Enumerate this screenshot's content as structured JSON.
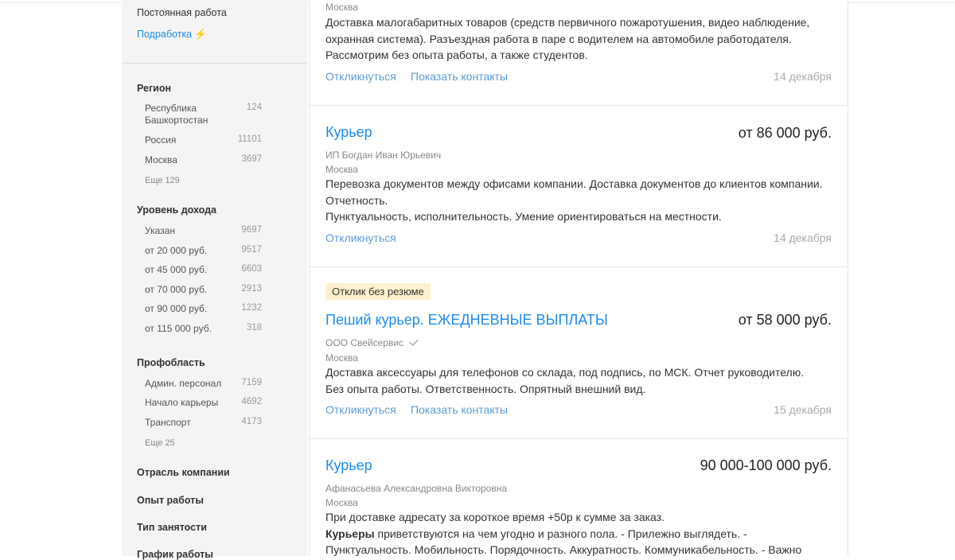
{
  "sidebar": {
    "employment_links": [
      {
        "label": "Постоянная работа"
      },
      {
        "label": "Подработка",
        "icon": "lightning-icon"
      }
    ],
    "region": {
      "heading": "Регион",
      "items": [
        {
          "label": "Республика Башкортостан",
          "count": "124"
        },
        {
          "label": "Россия",
          "count": "11101"
        },
        {
          "label": "Москва",
          "count": "3697"
        }
      ],
      "more": "Еще 129"
    },
    "income": {
      "heading": "Уровень дохода",
      "items": [
        {
          "label": "Указан",
          "count": "9697"
        },
        {
          "label": "от 20 000 руб.",
          "count": "9517"
        },
        {
          "label": "от 45 000 руб.",
          "count": "6603"
        },
        {
          "label": "от 70 000 руб.",
          "count": "2913"
        },
        {
          "label": "от 90 000 руб.",
          "count": "1232"
        },
        {
          "label": "от 115 000 руб.",
          "count": "318"
        }
      ]
    },
    "profarea": {
      "heading": "Профобласть",
      "items": [
        {
          "label": "Админ. персонал",
          "count": "7159"
        },
        {
          "label": "Начало карьеры",
          "count": "4692"
        },
        {
          "label": "Транспорт",
          "count": "4173"
        }
      ],
      "more": "Еще 25"
    },
    "sections": [
      "Отрасль компании",
      "Опыт работы",
      "Тип занятости",
      "График работы"
    ]
  },
  "vacancies": [
    {
      "city": "Москва",
      "description": [
        "Доставка малогабаритных товаров (средств первичного пожаротушения, видео наблюдение,",
        "охранная система). Разъездная работа в паре с водителем на автомобиле работодателя.",
        "Рассмотрим без опыта работы, а также студентов."
      ],
      "respond": "Откликнуться",
      "contacts": "Показать контакты",
      "date": "14 декабря"
    },
    {
      "title": "Курьер",
      "salary": "от 86 000 руб.",
      "company": "ИП Богдан Иван Юрьевич",
      "city": "Москва",
      "description": [
        "Перевозка документов между офисами компании. Доставка документов до клиентов компании.",
        "Отчетность.",
        "Пунктуальность, исполнительность. Умение ориентироваться на местности."
      ],
      "respond": "Откликнуться",
      "date": "14 декабря"
    },
    {
      "badge": "Отклик без резюме",
      "title": "Пеший курьер. ЕЖЕДНЕВНЫЕ ВЫПЛАТЫ",
      "salary": "от 58 000 руб.",
      "company": "ООО Свейсервис",
      "company_icon": "verified-check-icon",
      "city": "Москва",
      "description": [
        "Доставка аксессуары для телефонов со склада, под подпись, по МСК. Отчет руководителю.",
        "Без опыта работы. Ответственность. Опрятный внешний вид."
      ],
      "respond": "Откликнуться",
      "contacts": "Показать контакты",
      "date": "15 декабря"
    },
    {
      "title": "Курьер",
      "salary": "90 000-100 000 руб.",
      "company": "Афанасьева Александровна Викторовна",
      "city": "Москва",
      "description_line1": "При доставке адресату за короткое время +50р к сумме за заказ.",
      "description_line2_bold": "Курьеры",
      "description_line2_rest": " приветствуются на чем угодно и разного пола. - Прилежно выглядеть. -",
      "description_line3": "Пунктуальность. Мобильность. Порядочность. Аккуратность. Коммуникабельность. - Важно"
    }
  ],
  "colors": {
    "link": "#1f8ce6",
    "action": "#5c9ad6",
    "badge_bg": "#fdf1cd",
    "sidebar_bg": "#f4f4f4"
  }
}
